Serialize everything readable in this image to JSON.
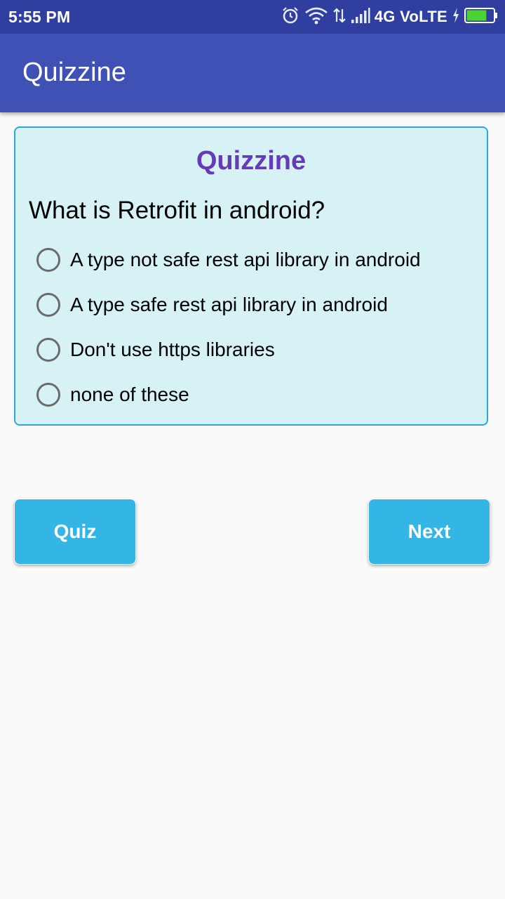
{
  "status_bar": {
    "time": "5:55 PM",
    "network": "4G VoLTE",
    "icons": [
      "alarm-icon",
      "wifi-icon",
      "data-arrows-icon",
      "signal-icon",
      "charging-icon",
      "battery-icon"
    ],
    "battery_level_fraction": 0.75,
    "battery_color": "#4cd137"
  },
  "app_bar": {
    "title": "Quizzine"
  },
  "quiz_card": {
    "title": "Quizzine",
    "question": "What is Retrofit in android?",
    "options": [
      {
        "label": "A type not safe rest api library in android",
        "selected": false
      },
      {
        "label": "A type safe rest api library in android",
        "selected": false
      },
      {
        "label": "Don't use https libraries",
        "selected": false
      },
      {
        "label": "none of these",
        "selected": false
      }
    ]
  },
  "buttons": {
    "quiz_label": "Quiz",
    "next_label": "Next"
  },
  "colors": {
    "status_bar": "#303f9f",
    "app_bar": "#3f51b5",
    "card_background": "#d6f2f5",
    "card_border": "#2aa7e0",
    "card_title": "#673ab7",
    "button": "#33b5e5"
  }
}
